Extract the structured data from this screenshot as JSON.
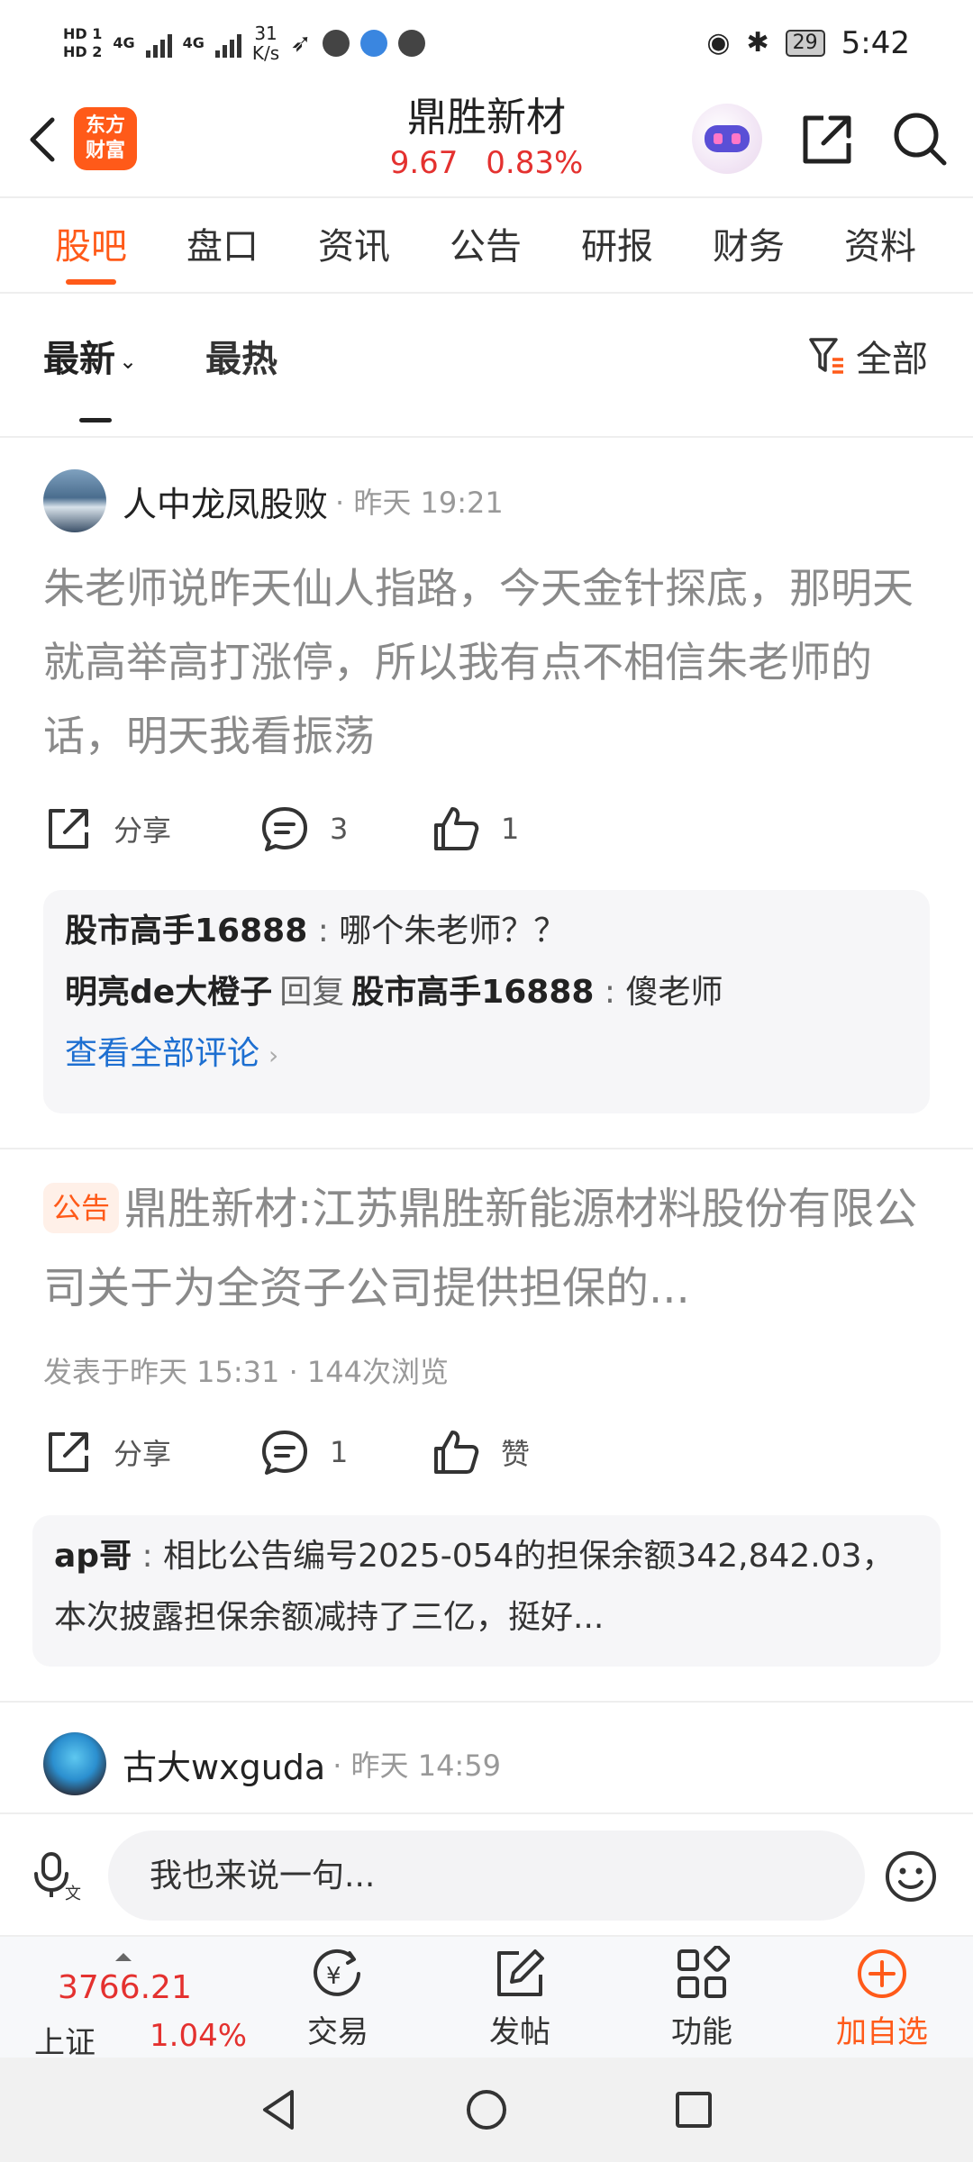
{
  "status_bar": {
    "hd1": "HD 1",
    "hd2": "HD 2",
    "net1": "4G",
    "net2": "4G",
    "speed_value": "31",
    "speed_unit": "K/s",
    "battery": "29",
    "time": "5:42"
  },
  "header": {
    "logo_line1": "东方",
    "logo_line2": "财富",
    "stock_name": "鼎胜新材",
    "price": "9.67",
    "change_pct": "0.83%"
  },
  "tabs": [
    {
      "label": "股吧"
    },
    {
      "label": "盘口"
    },
    {
      "label": "资讯"
    },
    {
      "label": "公告"
    },
    {
      "label": "研报"
    },
    {
      "label": "财务"
    },
    {
      "label": "资料"
    }
  ],
  "sort": {
    "latest": "最新",
    "hot": "最热",
    "filter": "全部"
  },
  "post1": {
    "author": "人中龙凤股败",
    "time": "· 昨天 19:21",
    "body": "朱老师说昨天仙人指路，今天金针探底，那明天就高举高打涨停，所以我有点不相信朱老师的话，明天我看振荡",
    "share": "分享",
    "comments": "3",
    "likes": "1",
    "comment1_user": "股市高手16888",
    "comment1_text": "哪个朱老师？？",
    "comment2_user": "明亮de大橙子",
    "comment2_reply_word": "回复",
    "comment2_target": "股市高手16888",
    "comment2_text": "傻老师",
    "view_all": "查看全部评论"
  },
  "post2": {
    "badge": "公告",
    "title": "鼎胜新材:江苏鼎胜新能源材料股份有限公司关于为全资子公司提供担保的...",
    "meta": "发表于昨天 15:31 · 144次浏览",
    "share": "分享",
    "comments": "1",
    "likes": "赞",
    "comment_user": "ap哥",
    "comment_text": "相比公告编号2025-054的担保余额342,842.03，本次披露担保余额减持了三亿，挺好..."
  },
  "post3": {
    "author": "古大wxguda",
    "time": "· 昨天 14:59"
  },
  "input": {
    "placeholder": "我也来说一句..."
  },
  "bottom_nav": {
    "index_value": "3766.21",
    "index_name": "上证",
    "index_pct": "1.04%",
    "trade": "交易",
    "post": "发帖",
    "functions": "功能",
    "add_watch": "加自选"
  },
  "colors": {
    "accent": "#ff5a19",
    "up_red": "#e4312f",
    "link_blue": "#1d6fd1"
  }
}
